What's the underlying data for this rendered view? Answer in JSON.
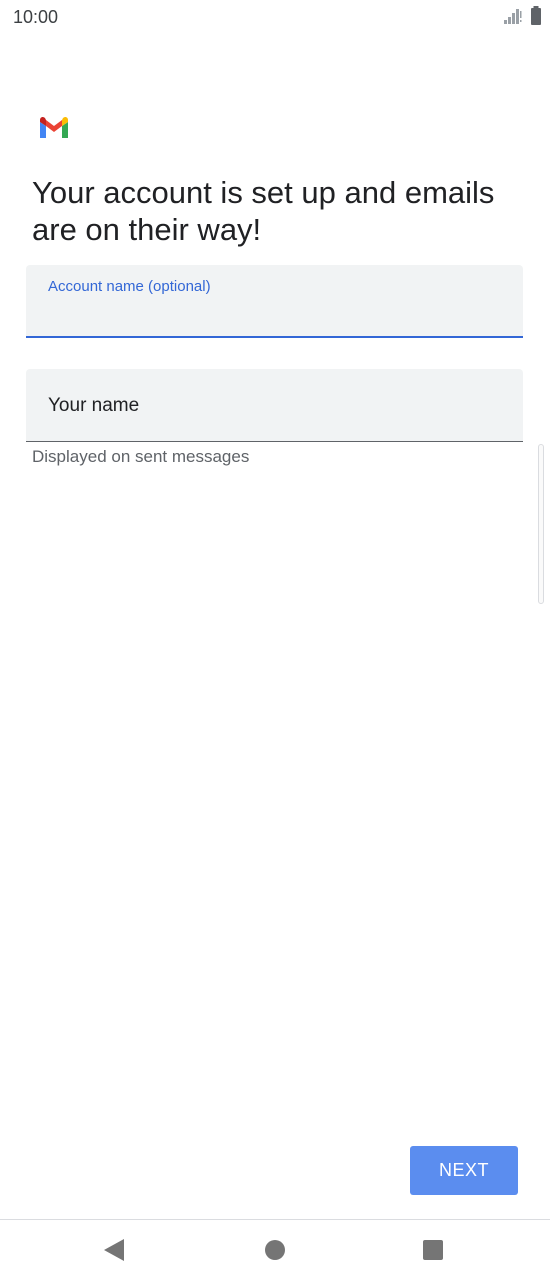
{
  "status_bar": {
    "time": "10:00",
    "icons": [
      "signal-icon",
      "battery-icon"
    ]
  },
  "app": {
    "logo": "gmail-logo"
  },
  "headline": "Your account is set up and emails are on their way!",
  "fields": {
    "account_name": {
      "label": "Account name (optional)",
      "value": ""
    },
    "your_name": {
      "placeholder": "Your name",
      "helper": "Displayed on sent messages"
    }
  },
  "actions": {
    "next_label": "NEXT"
  },
  "nav": {
    "icons": [
      "back-icon",
      "home-icon",
      "recents-icon"
    ]
  },
  "colors": {
    "accent": "#3367d6",
    "button": "#5b8def",
    "field_bg": "#f1f3f4"
  }
}
